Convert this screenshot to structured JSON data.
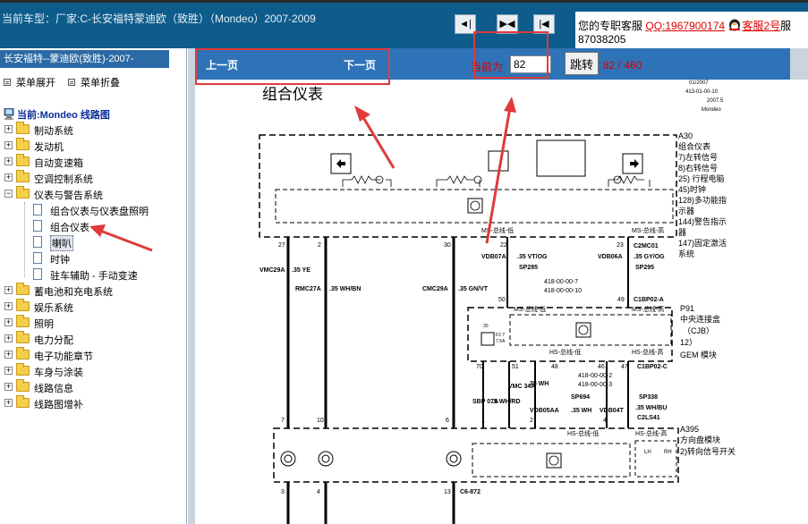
{
  "header": {
    "car_title": "当前车型：厂家:C-长安福特蒙迪欧（致胜）（Mondeo）2007-2009",
    "service_label": "您的专职客服",
    "qq_text": "QQ:1967900174",
    "agent_text": "客服2号",
    "service_tail": "服",
    "phone": "87038205",
    "nav_buttons": [
      "first-page",
      "prev-next",
      "last-page"
    ]
  },
  "sidebar": {
    "title": "长安福特--蒙迪欧(致胜)-2007-",
    "expand_label": "菜单展开",
    "collapse_label": "菜单折叠",
    "current_label": "当前:Mondeo 线路图",
    "items": [
      {
        "label": "制动系统",
        "type": "folder",
        "state": "+"
      },
      {
        "label": "发动机",
        "type": "folder",
        "state": "+"
      },
      {
        "label": "自动变速箱",
        "type": "folder",
        "state": "+"
      },
      {
        "label": "空调控制系统",
        "type": "folder",
        "state": "+"
      },
      {
        "label": "仪表与警告系统",
        "type": "folder",
        "state": "-"
      },
      {
        "label": "组合仪表与仪表盘照明",
        "type": "doc"
      },
      {
        "label": "组合仪表",
        "type": "doc"
      },
      {
        "label": "喇叭",
        "type": "doc",
        "selected": true
      },
      {
        "label": "时钟",
        "type": "doc"
      },
      {
        "label": "驻车辅助 - 手动变速",
        "type": "doc"
      },
      {
        "label": "蓄电池和充电系统",
        "type": "folder",
        "state": "+"
      },
      {
        "label": "娱乐系统",
        "type": "folder",
        "state": "+"
      },
      {
        "label": "照明",
        "type": "folder",
        "state": "+"
      },
      {
        "label": "电力分配",
        "type": "folder",
        "state": "+"
      },
      {
        "label": "电子功能章节",
        "type": "folder",
        "state": "+"
      },
      {
        "label": "车身与涂装",
        "type": "folder",
        "state": "+"
      },
      {
        "label": "线路信息",
        "type": "folder",
        "state": "+"
      },
      {
        "label": "线路图增补",
        "type": "folder",
        "state": "+"
      }
    ]
  },
  "pager": {
    "prev_label": "上一页",
    "next_label": "下一页",
    "current_label": "当前为",
    "page_value": "82",
    "jump_label": "跳转",
    "page_count": "82 / 460"
  },
  "diagram": {
    "title": "组合仪表",
    "doc_date": "01/2007",
    "doc_code": "413-01-00-10",
    "doc_version": "2007.5",
    "doc_model": "Mondeo",
    "a30_code": "A30",
    "a30_lines": [
      "组合仪表",
      "7)左转信号",
      "8)右转信号",
      "25) 行程电脑",
      "45)时钟",
      "128)多功能指",
      "示器",
      "144)警告指示",
      "器",
      "147)固定激活",
      "系统"
    ],
    "p91_code": "P91",
    "p91_lines": [
      "中央连接盒",
      "（CJB）",
      "12）",
      "GEM 模块"
    ],
    "a395_code": "A395",
    "a395_lines": [
      "方向盘模块",
      "2)转向信号开关"
    ],
    "bus_ms_low": "MS-总线-低",
    "bus_ms_high": "MS-总线-高",
    "bus_hs_low": "HS-总线-低",
    "bus_hs_high": "HS-总线-高",
    "pins_top": [
      "27",
      "2",
      "30",
      "22",
      "23"
    ],
    "wires_left": [
      "VMC29A",
      ".35 YE",
      "RMC27A",
      ".35 WH/BN",
      "CMC29A",
      ".35 GN/VT"
    ],
    "wires_mid": [
      "VDB07A",
      ".35 VT/OG",
      "SP285",
      "VDB06A",
      ".35 GY/OG",
      "SP295"
    ],
    "connectors": [
      "C2MC01",
      "C1BP02-A",
      "C1BP02-C",
      "C2LS41",
      "C6-872"
    ],
    "codes_mid": [
      "418-00-00-7",
      "418-00-00-10",
      "418-00-00-2",
      "418-00-00-3"
    ],
    "pins_mid": [
      "50",
      "49",
      "70",
      "51",
      "48",
      "46",
      "47"
    ],
    "wires_low": [
      "SBP 07A",
      ".5 WH/RD",
      "VMC 34A",
      ".35 WH",
      "VDB05AA",
      "SP694",
      ".35 WH",
      "VDB04T",
      "SP338",
      ".35 WH/BU"
    ],
    "pins_low": [
      "7",
      "10",
      "6",
      "1",
      "2",
      "4",
      "3",
      "4",
      "13",
      "12"
    ],
    "fuse": [
      "30",
      "F2.7",
      "7.5A"
    ],
    "misc": [
      "145",
      "144",
      "7",
      "128",
      "25",
      "45",
      "147",
      "LIN",
      "LH",
      "RH"
    ]
  }
}
